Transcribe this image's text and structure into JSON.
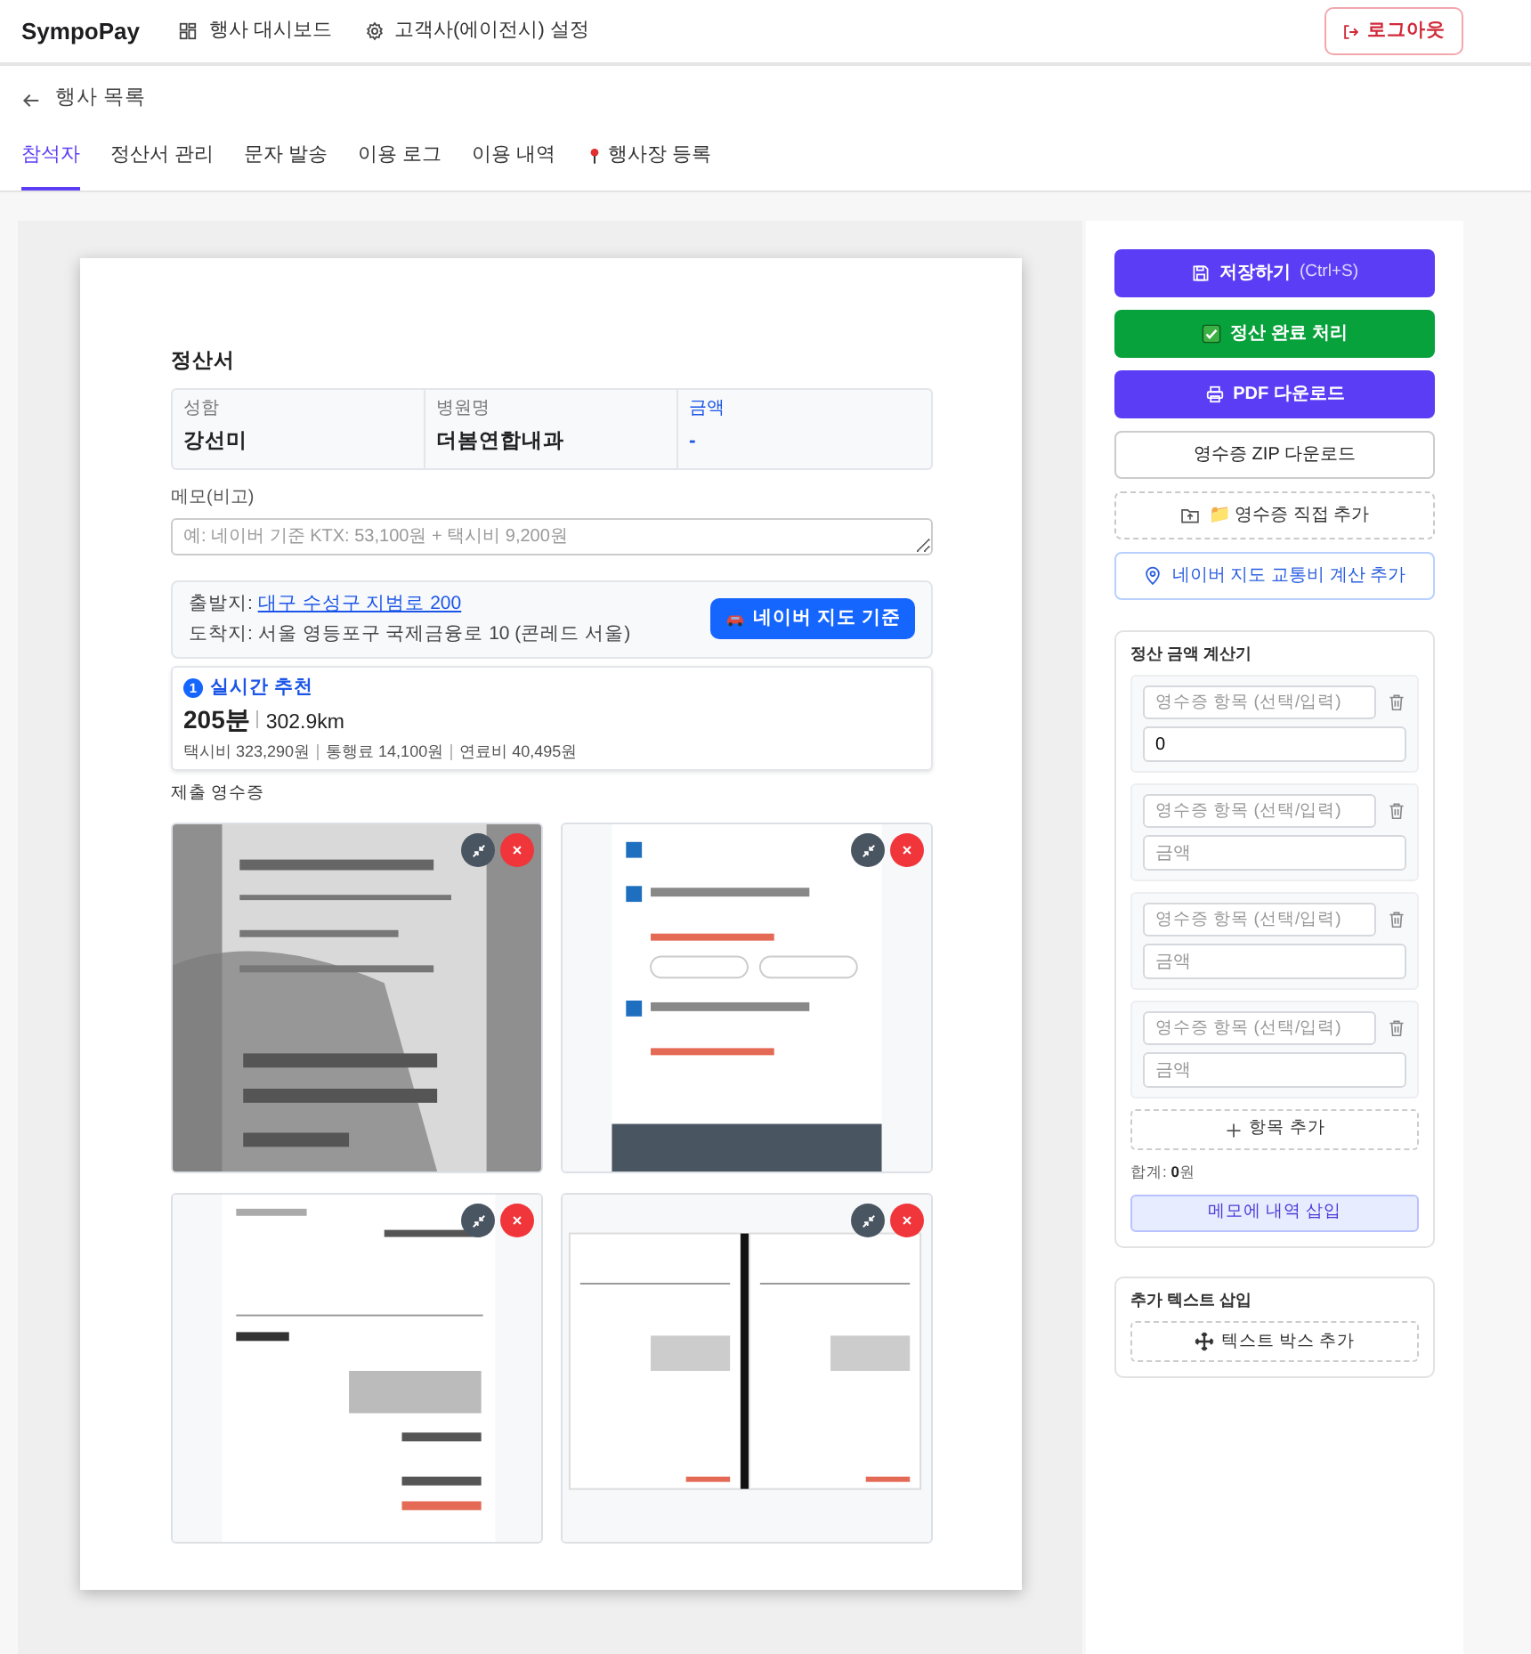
{
  "app": {
    "brand": "SympoPay",
    "nav": [
      {
        "label": "행사 대시보드",
        "kind": "dashboard"
      },
      {
        "label": "고객사(에이전시) 설정",
        "kind": "settings"
      }
    ],
    "logout": "로그아웃"
  },
  "back_link": "행사 목록",
  "tabs": [
    {
      "label": "참석자",
      "selected": true,
      "kind": "plain"
    },
    {
      "label": "정산서 관리",
      "selected": false,
      "kind": "plain"
    },
    {
      "label": "문자 발송",
      "selected": false,
      "kind": "plain"
    },
    {
      "label": "이용 로그",
      "selected": false,
      "kind": "plain"
    },
    {
      "label": "이용 내역",
      "selected": false,
      "kind": "plain"
    },
    {
      "label": "행사장 등록",
      "selected": false,
      "kind": "pin"
    }
  ],
  "statement": {
    "title": "정산서",
    "fields": [
      {
        "label": "성함",
        "value": "강선미",
        "accent": false
      },
      {
        "label": "병원명",
        "value": "더봄연합내과",
        "accent": false
      },
      {
        "label": "금액",
        "value": "-",
        "accent": true
      }
    ],
    "memo": {
      "label": "메모(비고)",
      "placeholder": "예: 네이버 기준 KTX: 53,100원 + 택시비 9,200원"
    },
    "route": {
      "origin_label": "출발지:",
      "origin": "대구 수성구 지범로 200",
      "destination": "도착지: 서울 영등포구 국제금융로 10 (콘레드 서울)",
      "map_button": "네이버 지도 기준"
    },
    "recommendation": {
      "rank": "1",
      "title": "실시간 추천",
      "duration": "205분",
      "distance": "302.9km",
      "costs": [
        "택시비 323,290원",
        "통행료 14,100원",
        "연료비 40,495원"
      ]
    },
    "receipts": {
      "title": "제출 영수증"
    }
  },
  "actions": [
    {
      "label": "저장하기",
      "shortcut": "(Ctrl+S)",
      "kind": "primary"
    },
    {
      "label": "정산 완료 처리",
      "kind": "success"
    },
    {
      "label": "PDF 다운로드",
      "kind": "primary"
    },
    {
      "label": "영수증 ZIP 다운로드",
      "kind": "outline"
    },
    {
      "label": "📁 영수증 직접 추가",
      "kind": "dashed"
    },
    {
      "label": "네이버 지도 교통비 계산 추가",
      "kind": "info"
    }
  ],
  "calculator": {
    "title": "정산 금액 계산기",
    "rows": [
      {
        "item_placeholder": "영수증 항목 (선택/입력)",
        "amount": "0"
      },
      {
        "item_placeholder": "영수증 항목 (선택/입력)",
        "amount_placeholder": "금액"
      },
      {
        "item_placeholder": "영수증 항목 (선택/입력)",
        "amount_placeholder": "금액"
      },
      {
        "item_placeholder": "영수증 항목 (선택/입력)",
        "amount_placeholder": "금액"
      }
    ],
    "add_button": "항목 추가",
    "total": "합계: **0**원",
    "insert_button": "메모에 내역 삽입"
  },
  "extra_text": {
    "title": "추가 텍스트 삽입",
    "add_button": "텍스트 박스 추가"
  }
}
